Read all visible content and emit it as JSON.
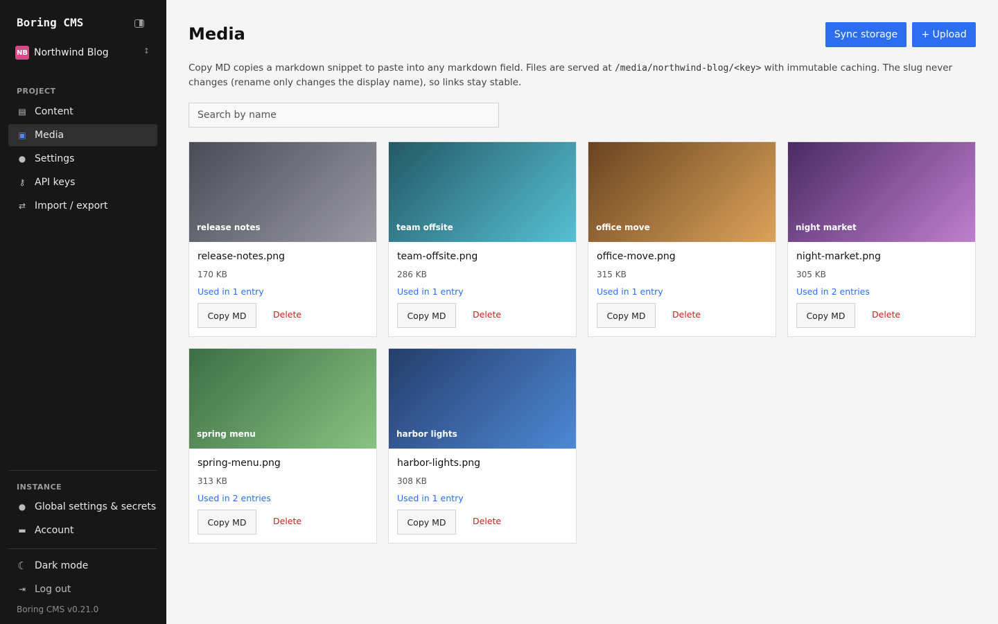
{
  "sidebar": {
    "brand": "Boring CMS",
    "collapse_icon": "sidebar-toggle-icon",
    "project": {
      "badge": "NB",
      "name": "Northwind Blog",
      "badge_color": "#d64a8a",
      "switch_icon": "↕"
    },
    "project_label": "PROJECT",
    "nav": [
      {
        "label": "Content",
        "icon": "▤",
        "active": false
      },
      {
        "label": "Media",
        "icon": "▣",
        "active": true
      },
      {
        "label": "Settings",
        "icon": "●",
        "active": false
      },
      {
        "label": "API keys",
        "icon": "⚷",
        "active": false
      },
      {
        "label": "Import / export",
        "icon": "⇄",
        "active": false
      }
    ],
    "instance_label": "INSTANCE",
    "instance_nav": [
      {
        "label": "Global settings & secrets",
        "icon": "●"
      },
      {
        "label": "Account",
        "icon": "▬"
      }
    ],
    "dark_mode": {
      "label": "Dark mode",
      "icon": "☾"
    },
    "logout": {
      "label": "Log out",
      "icon": "⇥"
    },
    "version": "Boring CMS v0.21.0"
  },
  "main": {
    "title": "Media",
    "sync_label": "Sync storage",
    "upload_label": "+ Upload",
    "intro_before": "Copy MD copies a markdown snippet to paste into any markdown field. Files are served at ",
    "intro_code": "/media/northwind-blog/<key>",
    "intro_after": " with immutable caching. The slug never changes (rename only changes the display name), so links stay stable.",
    "search_placeholder": "Search by name",
    "copy_label": "Copy MD",
    "delete_label": "Delete",
    "accent": "#2b6ff0",
    "danger": "#cc1f1f"
  },
  "media": [
    {
      "caption": "release notes",
      "file": "release-notes.png",
      "size": "170 KB",
      "usage": "Used in 1 entry",
      "from": "#4b4b57",
      "to": "#9a99a3"
    },
    {
      "caption": "team offsite",
      "file": "team-offsite.png",
      "size": "286 KB",
      "usage": "Used in 1 entry",
      "from": "#245965",
      "to": "#55c0d4"
    },
    {
      "caption": "office move",
      "file": "office-move.png",
      "size": "315 KB",
      "usage": "Used in 1 entry",
      "from": "#6a4320",
      "to": "#dca45a"
    },
    {
      "caption": "night market",
      "file": "night-market.png",
      "size": "305 KB",
      "usage": "Used in 2 entries",
      "from": "#4a2a63",
      "to": "#c07fd0"
    },
    {
      "caption": "spring menu",
      "file": "spring-menu.png",
      "size": "313 KB",
      "usage": "Used in 2 entries",
      "from": "#3c6e43",
      "to": "#89c283"
    },
    {
      "caption": "harbor lights",
      "file": "harbor-lights.png",
      "size": "308 KB",
      "usage": "Used in 1 entry",
      "from": "#253d6a",
      "to": "#4d88d6"
    }
  ]
}
